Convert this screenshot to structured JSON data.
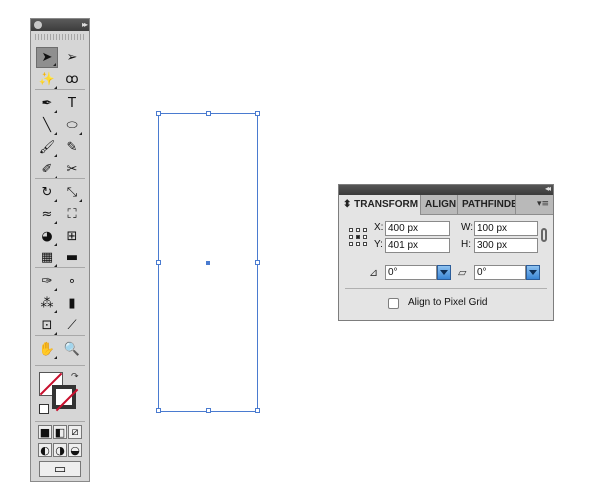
{
  "tools_panel": {
    "collapse_glyph": "▸▸",
    "tools": [
      {
        "name": "selection-tool",
        "icon": "selection-arrow-icon",
        "glyph": "➤"
      },
      {
        "name": "direct-selection-tool",
        "icon": "direct-selection-arrow-icon",
        "glyph": "➢"
      },
      {
        "name": "magic-wand-tool",
        "icon": "magic-wand-icon",
        "glyph": "✨"
      },
      {
        "name": "lasso-tool",
        "icon": "lasso-icon",
        "glyph": "ꝏ"
      },
      {
        "name": "pen-tool",
        "icon": "pen-icon",
        "glyph": "✒"
      },
      {
        "name": "type-tool",
        "icon": "type-icon",
        "glyph": "T"
      },
      {
        "name": "line-segment-tool",
        "icon": "line-segment-icon",
        "glyph": "╲"
      },
      {
        "name": "ellipse-tool",
        "icon": "ellipse-icon",
        "glyph": "⬭"
      },
      {
        "name": "paintbrush-tool",
        "icon": "paintbrush-icon",
        "glyph": "🖌"
      },
      {
        "name": "pencil-tool",
        "icon": "pencil-icon",
        "glyph": "✎"
      },
      {
        "name": "blob-brush-tool",
        "icon": "blob-brush-icon",
        "glyph": "✐"
      },
      {
        "name": "scissors-tool",
        "icon": "scissors-icon",
        "glyph": "✂"
      },
      {
        "name": "rotate-tool",
        "icon": "rotate-icon",
        "glyph": "↻"
      },
      {
        "name": "scale-tool",
        "icon": "scale-icon",
        "glyph": "⤡"
      },
      {
        "name": "warp-tool",
        "icon": "warp-icon",
        "glyph": "≈"
      },
      {
        "name": "free-transform-tool",
        "icon": "free-transform-icon",
        "glyph": "⛶"
      },
      {
        "name": "shape-builder-tool",
        "icon": "shape-builder-icon",
        "glyph": "◕"
      },
      {
        "name": "perspective-grid-tool",
        "icon": "perspective-grid-icon",
        "glyph": "⊞"
      },
      {
        "name": "mesh-tool",
        "icon": "mesh-icon",
        "glyph": "▦"
      },
      {
        "name": "gradient-tool",
        "icon": "gradient-icon",
        "glyph": "▬"
      },
      {
        "name": "eyedropper-tool",
        "icon": "eyedropper-icon",
        "glyph": "✑"
      },
      {
        "name": "blend-tool",
        "icon": "blend-icon",
        "glyph": "∘"
      },
      {
        "name": "symbol-sprayer-tool",
        "icon": "symbol-sprayer-icon",
        "glyph": "⁂"
      },
      {
        "name": "column-graph-tool",
        "icon": "column-graph-icon",
        "glyph": "▮"
      },
      {
        "name": "artboard-tool",
        "icon": "artboard-icon",
        "glyph": "⊡"
      },
      {
        "name": "slice-tool",
        "icon": "slice-icon",
        "glyph": "⟋"
      },
      {
        "name": "hand-tool",
        "icon": "hand-icon",
        "glyph": "✋"
      },
      {
        "name": "zoom-tool",
        "icon": "zoom-icon",
        "glyph": "🔍"
      },
      {
        "name": "color-mode-button",
        "icon": "color-mode-icon",
        "glyph": "■"
      },
      {
        "name": "gradient-mode-button",
        "icon": "gradient-mode-icon",
        "glyph": "◧"
      },
      {
        "name": "none-mode-button",
        "icon": "none-mode-icon",
        "glyph": "⧄"
      },
      {
        "name": "draw-normal-button",
        "icon": "draw-normal-icon",
        "glyph": "◐"
      },
      {
        "name": "draw-behind-button",
        "icon": "draw-behind-icon",
        "glyph": "◑"
      },
      {
        "name": "draw-inside-button",
        "icon": "draw-inside-icon",
        "glyph": "◒"
      },
      {
        "name": "change-screen-mode-button",
        "icon": "screen-mode-icon",
        "glyph": "▭"
      }
    ],
    "swap_glyph": "↷"
  },
  "transform_panel": {
    "collapse_glyph": "◂◂",
    "tabs": [
      {
        "label": "TRANSFORM",
        "prefix": "⬍ ",
        "active": true
      },
      {
        "label": "ALIGN",
        "active": false
      },
      {
        "label": "PATHFINDE",
        "active": false
      }
    ],
    "menu_glyph": "▾≡",
    "x": {
      "label": "X:",
      "value": "400 px"
    },
    "y": {
      "label": "Y:",
      "value": "401 px"
    },
    "w": {
      "label": "W:",
      "value": "100 px"
    },
    "h": {
      "label": "H:",
      "value": "300 px"
    },
    "rotate": {
      "value": "0°",
      "icon_glyph": "⊿"
    },
    "shear": {
      "value": "0°",
      "icon_glyph": "▱"
    },
    "align_pixel_grid": {
      "label": "Align to Pixel Grid",
      "checked": false
    }
  },
  "colors": {
    "selection": "#4a7bd0",
    "combo_button": "#3a86d6",
    "none_slash": "#c8102e"
  }
}
